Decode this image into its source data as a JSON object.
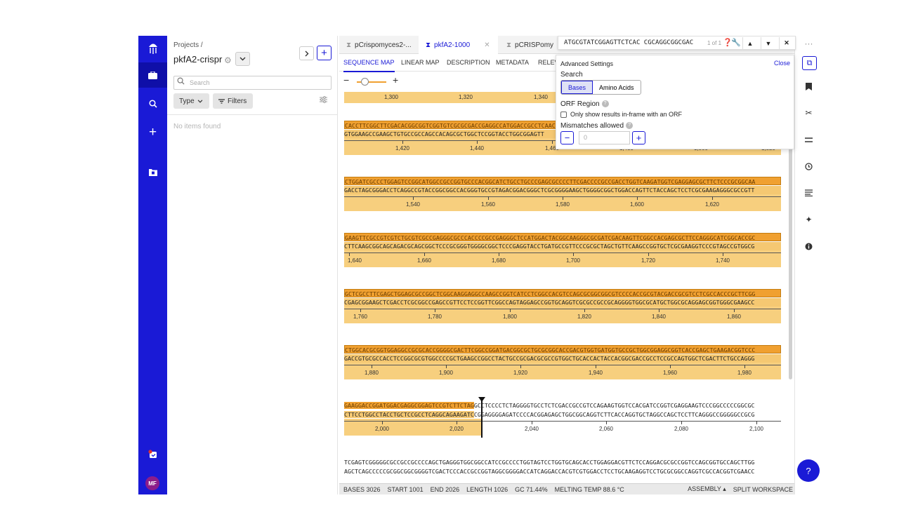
{
  "rail": {
    "logo_icon": "jellyfish-logo-icon",
    "items": [
      {
        "name": "projects",
        "icon": "briefcase-icon",
        "glyph": "▣"
      },
      {
        "name": "search",
        "icon": "search-icon",
        "glyph": "⌕"
      },
      {
        "name": "create",
        "icon": "plus-icon",
        "glyph": "+"
      },
      {
        "name": "folders",
        "icon": "folder-icon",
        "glyph": "▤"
      }
    ],
    "avatar": "MF"
  },
  "projects": {
    "breadcrumb": "Projects /",
    "title": "pkfA2-crispr",
    "search_placeholder": "Search",
    "type_label": "Type",
    "filters_label": "Filters",
    "empty_text": "No items found"
  },
  "tabs": [
    {
      "label": "pCrispomyces2-..."
    },
    {
      "label": "pkfA2-1000"
    },
    {
      "label": "pCRISPomy"
    }
  ],
  "subtabs": [
    "SEQUENCE MAP",
    "LINEAR MAP",
    "DESCRIPTION",
    "METADATA",
    "RELEV"
  ],
  "find": {
    "query": "ATGCGTATCGGAGTTCTCAC CGCAGGCGGCGAC",
    "count": "1 of 1"
  },
  "advanced": {
    "title": "Advanced Settings",
    "close": "Close",
    "search_label": "Search",
    "bases": "Bases",
    "amino": "Amino Acids",
    "orf_label": "ORF Region",
    "orf_check": "Only show results in-frame with an ORF",
    "mismatch_label": "Mismatches allowed",
    "mismatch_value": "0"
  },
  "ruler_top": {
    "labels": [
      "1,300",
      "1,320",
      "1,340"
    ]
  },
  "blocks": [
    {
      "top": "CACCTTCGGCTTCGACACGGCGGTCGGTGTCGCGCGACCGAGGCCATGGACCGCCTCAAC",
      "bottom": "GTGGAAGCCGAAGCTGTGCCGCCAGCCACAGCGCTGGCTCCGGTACCTGGCGGAGTT",
      "labels": [
        "1,420",
        "1,440",
        "1,460",
        "1,480",
        "1,500",
        "1,520"
      ]
    },
    {
      "top": "CTGGATCGCCCTGGAGTCCGGCATGGCCGCCGGTGCCCACGGCATCTGCCTGCCCGAGCGCCCCTTCGACCCCGCCGACCTGGTCAAGATGGTCGAGGAGCGCTTCTCCCGCGGCAA",
      "bottom": "GACCTAGCGGGACCTCAGGCCGTACCGGCGGCCACGGGTGCCGTAGACGGACGGGCTCGCGGGGAAGCTGGGGCGGCTGGACCAGTTCTACCAGCTCCTCGCGAAGAGGGCGCCGTT",
      "labels": [
        "1,540",
        "1,560",
        "1,580",
        "1,600",
        "1,620"
      ]
    },
    {
      "top": "GAAGTTCGCCGTCGTCTGCGTCGCCGAGGGCGCCCACCCCGCCGAGGGCTCCATGGACTACGGCAAGGGCGCGATCGACAAGTTCGGCCACGAGCGCTTCCAGGGCATCGGCACCGC",
      "bottom": "CTTCAAGCGGCAGCAGACGCAGCGGCTCCCGCGGGTGGGGCGGCTCCCGAGGTACCTGATGCCGTTCCCGCGCTAGCTGTTCAAGCCGGTGCTCGCGAAGGTCCCGTAGCCGTGGCG",
      "labels": [
        "1,640",
        "1,660",
        "1,680",
        "1,700",
        "1,720",
        "1,740"
      ]
    },
    {
      "top": "GCTCGCCTTCGAGCTGGAGCGCCGGCTCGGCAAGGAGGCCAAGCCGGTCATCCTCGGCCACGTCCAGCGCGGCGGCGTCCCCACCGCGTACGACCGCGTCCTCGCCACCCGCTTCGG",
      "bottom": "CGAGCGGAAGCTCGACCTCGCGGCCGAGCCGTTCCTCCGGTTCGGCCAGTAGGAGCCGGTGCAGGTCGCGCCGCCGCAGGGGTGGCGCATGCTGGCGCAGGAGCGGTGGGCGAAGCC",
      "labels": [
        "1,760",
        "1,780",
        "1,800",
        "1,820",
        "1,840",
        "1,860"
      ]
    },
    {
      "top": "CTGGCACGCGGTGGAGGCCGCGCACCGGGGCGACTTCGGCCGGATGACGGCGCTGCGCGGCACCGACGTGGTGATGGTGCCGCTGGCGGAGGCGGTCACCGAGCTGAAGACGGTCCC",
      "bottom": "GACCGTGCGCCACCTCCGGCGCGTGGCCCCGCTGAAGCCGGCCTACTGCCGCGACGCGCCGTGGCTGCACCACTACCACGGCGACCGCCTCCGCCAGTGGCTCGACTTCTGCCAGGG",
      "labels": [
        "1,880",
        "1,900",
        "1,920",
        "1,940",
        "1,960",
        "1,980"
      ]
    },
    {
      "top_hl": "GAAGGACCGGATGGACGAGGCGGAGTCCGTCTTCTAG",
      "top_rest": "GCCTCCCCTCTAGGGGTGCCTCTCGACCGCCGTCCAGAAGTGGTCCACGATCCGGTCGAGGAAGTCCCGGCCCCCGGCGC",
      "bottom_hl": "CTTCCTGGCCTACCTGCTCCGCCTCAGGCAGAAGATC",
      "bottom_rest": "CGGAGGGGAGATCCCCACGGAGAGCTGGCGGCAGGTCTTCACCAGGTGCTAGGCCAGCTCCTTCAGGGCCGGGGGCCGCG",
      "labels": [
        "2,000",
        "2,020",
        "2,040",
        "2,060",
        "2,080",
        "2,100"
      ]
    },
    {
      "top": "TCGAGTCGGGGGCGCCGCCGCCCCAGCTGAGGGTGGCGGCCATCCGCCCCTGGTAGTCCTGGTGCAGCACCTGGAGGACGTTCTCCAGGACGCGCCGGTCCAGCGGTGCCAGCTTGG",
      "bottom": "AGCTCAGCCCCCGCGGCGGCGGGGTCGACTCCCACCGCCGGTAGGCGGGGACCATCAGGACCACGTCGTGGACCTCCTGCAAGAGGTCCTGCGCGGCCAGGTCGCCACGGTCGAACC"
    }
  ],
  "status": {
    "bases": "BASES 3026",
    "start": "START 1001",
    "end": "END 2026",
    "length": "LENGTH 1026",
    "gc": "GC 71.44%",
    "melting": "MELTING TEMP 88.6 °C",
    "assembly": "ASSEMBLY ▴",
    "split": "SPLIT WORKSPACE"
  },
  "tools": [
    "bookmark-icon",
    "scissors-icon",
    "align-icon",
    "history-icon",
    "list-icon",
    "sparkle-icon",
    "info-icon"
  ],
  "fab": "?"
}
